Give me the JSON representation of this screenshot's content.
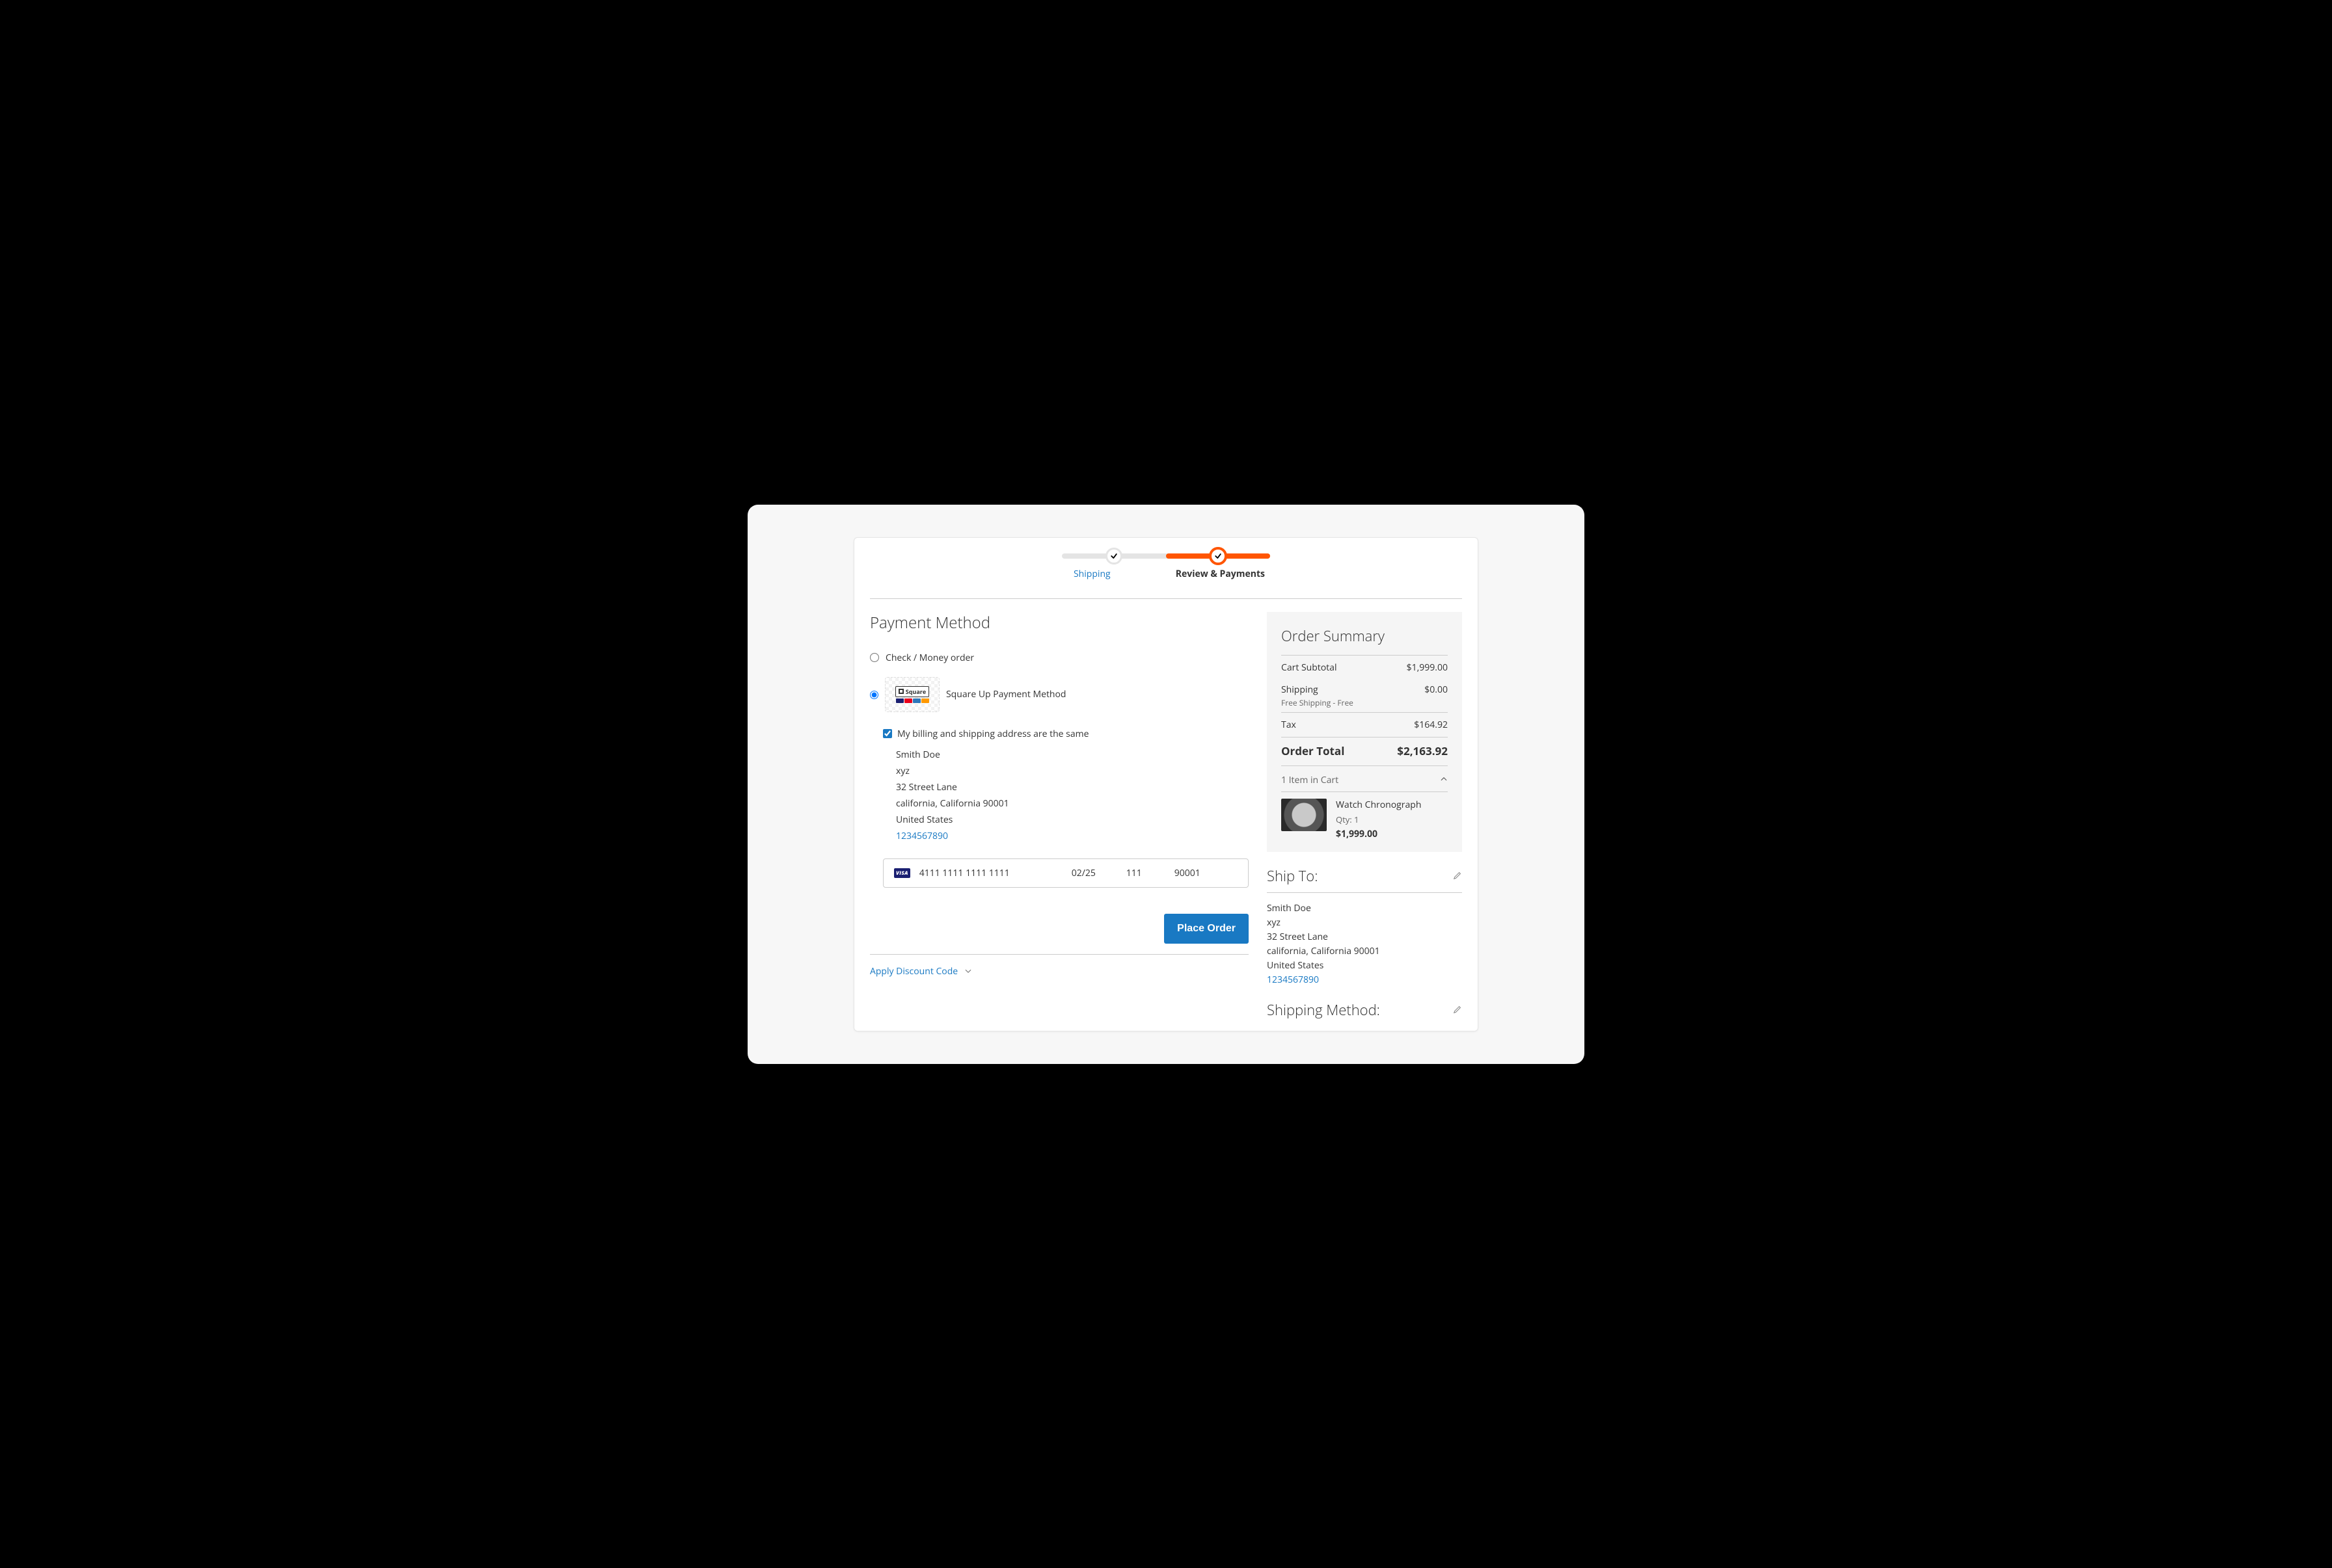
{
  "progress": {
    "step1_label": "Shipping",
    "step2_label": "Review & Payments"
  },
  "payment": {
    "title": "Payment Method",
    "option_check": "Check / Money order",
    "option_square": "Square Up Payment Method",
    "billing_same_label": "My billing and shipping address are the same",
    "address": {
      "name": "Smith Doe",
      "company": "xyz",
      "street": "32 Street Lane",
      "region": "california, California 90001",
      "country": "United States",
      "phone": "1234567890"
    },
    "card": {
      "brand": "VISA",
      "number": "4111 1111 1111 1111",
      "expiry": "02/25",
      "cvv": "111",
      "zip": "90001"
    },
    "place_order_label": "Place Order",
    "discount_label": "Apply Discount Code"
  },
  "summary": {
    "title": "Order Summary",
    "subtotal_label": "Cart Subtotal",
    "subtotal_value": "$1,999.00",
    "shipping_label": "Shipping",
    "shipping_value": "$0.00",
    "shipping_method": "Free Shipping - Free",
    "tax_label": "Tax",
    "tax_value": "$164.92",
    "total_label": "Order Total",
    "total_value": "$2,163.92",
    "cart_count_label": "1 Item in Cart",
    "item": {
      "name": "Watch Chronograph",
      "qty": "Qty: 1",
      "price": "$1,999.00"
    }
  },
  "shipto": {
    "title": "Ship To:",
    "address": {
      "name": "Smith Doe",
      "company": "xyz",
      "street": "32 Street Lane",
      "region": "california, California 90001",
      "country": "United States",
      "phone": "1234567890"
    }
  },
  "shipping_method": {
    "title": "Shipping Method:"
  },
  "icons": {
    "square_brand": "Square"
  }
}
